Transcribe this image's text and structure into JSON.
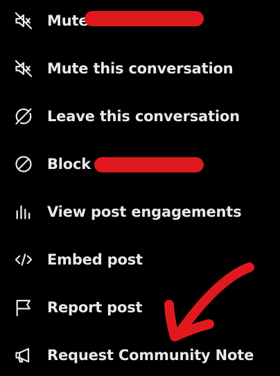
{
  "menu": {
    "items": [
      {
        "label": "Mute",
        "icon": "mute-icon",
        "redacted": true
      },
      {
        "label": "Mute this conversation",
        "icon": "mute-icon",
        "redacted": false
      },
      {
        "label": "Leave this conversation",
        "icon": "leave-icon",
        "redacted": false
      },
      {
        "label": "Block",
        "icon": "block-icon",
        "redacted": true
      },
      {
        "label": "View post engagements",
        "icon": "engagements-icon",
        "redacted": false
      },
      {
        "label": "Embed post",
        "icon": "embed-icon",
        "redacted": false
      },
      {
        "label": "Report post",
        "icon": "flag-icon",
        "redacted": false
      },
      {
        "label": "Request Community Note",
        "icon": "megaphone-icon",
        "redacted": false
      }
    ]
  },
  "colors": {
    "background": "#000000",
    "text": "#e7e9ea",
    "redaction": "#e0191f",
    "annotation": "#e0191f"
  }
}
